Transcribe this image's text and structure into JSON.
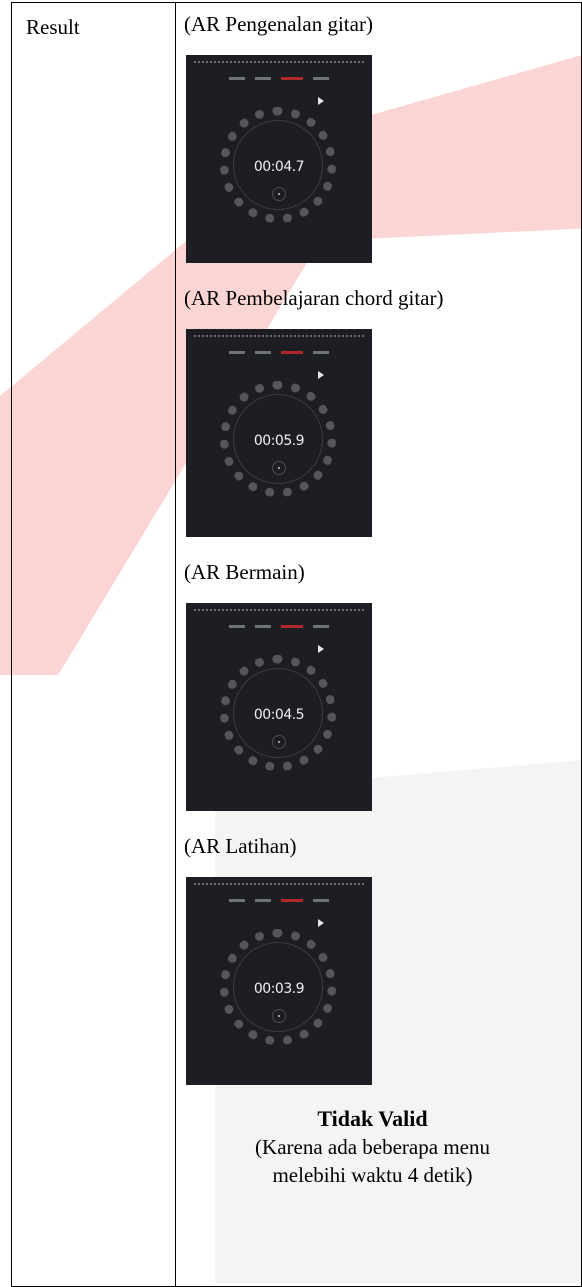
{
  "table": {
    "label": "Result",
    "sections": [
      {
        "caption": "(AR Pengenalan gitar)",
        "timer": "00:04.7"
      },
      {
        "caption": "(AR Pembelajaran chord gitar)",
        "timer": "00:05.9"
      },
      {
        "caption": "(AR Bermain)",
        "timer": "00:04.5"
      },
      {
        "caption": "(AR Latihan)",
        "timer": "00:03.9"
      }
    ],
    "verdict_title": "Tidak Valid",
    "verdict_note_1": "(Karena ada beberapa menu",
    "verdict_note_2": "melebihi  waktu 4 detik)"
  },
  "colors": {
    "screen_bg": "#1c1e24",
    "active_tab": "#d22a2a",
    "watermark_red": "#fbd2d2"
  }
}
